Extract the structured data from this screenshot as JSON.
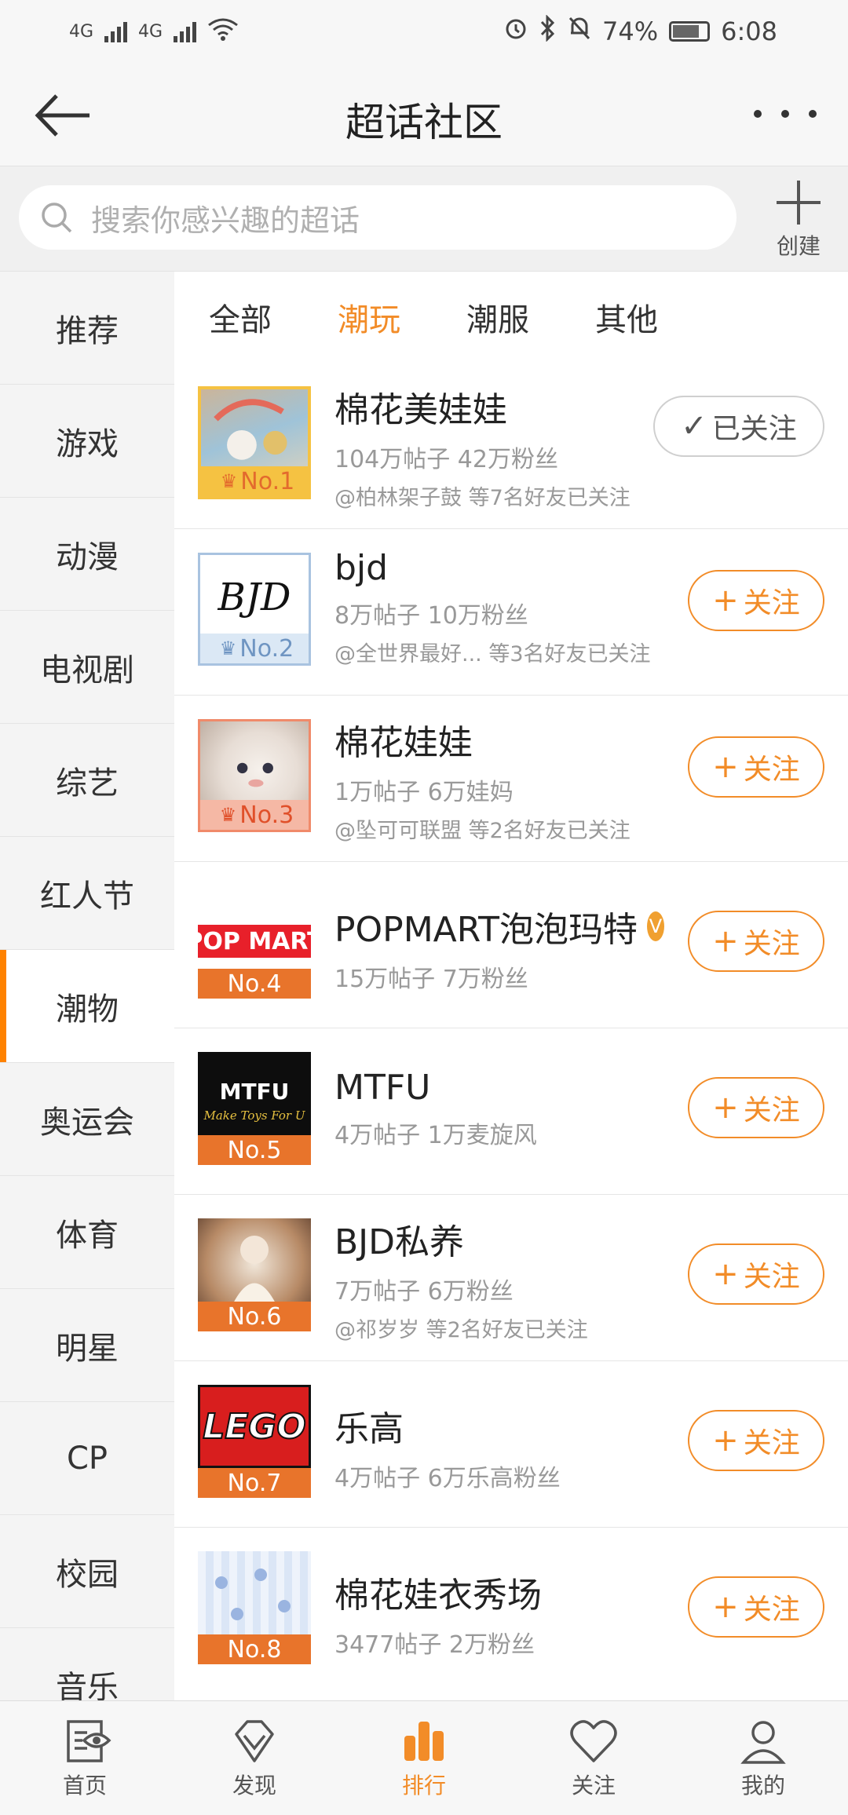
{
  "status_bar": {
    "signal1": "4G",
    "signal2": "4G",
    "battery": "74%",
    "time": "6:08"
  },
  "header": {
    "title": "超话社区"
  },
  "search": {
    "placeholder": "搜索你感兴趣的超话",
    "create_label": "创建"
  },
  "sidebar": {
    "items": [
      {
        "label": "推荐"
      },
      {
        "label": "游戏"
      },
      {
        "label": "动漫"
      },
      {
        "label": "电视剧"
      },
      {
        "label": "综艺"
      },
      {
        "label": "红人节"
      },
      {
        "label": "潮物"
      },
      {
        "label": "奥运会"
      },
      {
        "label": "体育"
      },
      {
        "label": "明星"
      },
      {
        "label": "CP"
      },
      {
        "label": "校园"
      },
      {
        "label": "音乐"
      }
    ],
    "active_index": 6
  },
  "tabs": [
    {
      "label": "全部"
    },
    {
      "label": "潮玩"
    },
    {
      "label": "潮服"
    },
    {
      "label": "其他"
    }
  ],
  "rows": [
    {
      "name": "棉花美娃娃",
      "stats": "104万帖子 42万粉丝",
      "friends": "@柏林架子鼓 等7名好友已关注",
      "rank": "No.1",
      "button": "已关注"
    },
    {
      "name": "bjd",
      "stats": "8万帖子 10万粉丝",
      "friends": "@全世界最好... 等3名好友已关注",
      "rank": "No.2",
      "button": "关注",
      "art_text": "BJD"
    },
    {
      "name": "棉花娃娃",
      "stats": "1万帖子 6万娃妈",
      "friends": "@坠可可联盟 等2名好友已关注",
      "rank": "No.3",
      "button": "关注"
    },
    {
      "name": "POPMART泡泡玛特",
      "stats": "15万帖子 7万粉丝",
      "friends": "",
      "rank": "No.4",
      "button": "关注",
      "art_text": "POP MART"
    },
    {
      "name": "MTFU",
      "stats": "4万帖子 1万麦旋风",
      "friends": "",
      "rank": "No.5",
      "button": "关注",
      "art_text": "MTFU",
      "art_sub": "Make Toys For U"
    },
    {
      "name": "BJD私养",
      "stats": "7万帖子 6万粉丝",
      "friends": "@祁岁岁 等2名好友已关注",
      "rank": "No.6",
      "button": "关注"
    },
    {
      "name": "乐高",
      "stats": "4万帖子 6万乐高粉丝",
      "friends": "",
      "rank": "No.7",
      "button": "关注",
      "art_text": "LEGO"
    },
    {
      "name": "棉花娃衣秀场",
      "stats": "3477帖子 2万粉丝",
      "friends": "",
      "rank": "No.8",
      "button": "关注"
    }
  ],
  "bottom_nav": [
    {
      "label": "首页",
      "icon": "home-eye-icon"
    },
    {
      "label": "发现",
      "icon": "diamond-icon"
    },
    {
      "label": "排行",
      "icon": "ranking-bars-icon"
    },
    {
      "label": "关注",
      "icon": "heart-icon"
    },
    {
      "label": "我的",
      "icon": "person-icon"
    }
  ],
  "colors": {
    "accent": "#f28c28",
    "rank_badge": "#e8742b",
    "gold_badge": "#f5c242",
    "silver_badge": "#a9c3e0"
  }
}
